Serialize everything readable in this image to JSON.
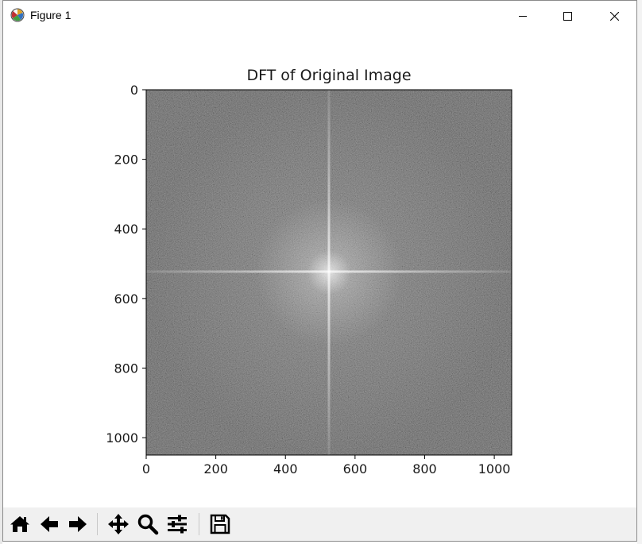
{
  "window": {
    "title": "Figure 1",
    "icons": [
      "matplotlib-logo-icon",
      "minimize-icon",
      "maximize-icon",
      "close-icon"
    ]
  },
  "toolbar": {
    "buttons": [
      "home-icon",
      "back-arrow-icon",
      "forward-arrow-icon",
      "pan-icon",
      "zoom-icon",
      "configure-subplots-icon",
      "save-icon"
    ]
  },
  "chart_data": {
    "type": "heatmap",
    "title": "DFT of Original Image",
    "xlabel": "",
    "ylabel": "",
    "xlim": [
      0,
      1050
    ],
    "ylim": [
      1050,
      0
    ],
    "x_ticks": [
      "0",
      "200",
      "400",
      "600",
      "800",
      "1000"
    ],
    "y_ticks": [
      "0",
      "200",
      "400",
      "600",
      "800",
      "1000"
    ],
    "colormap": "gray",
    "bright_center": [
      525,
      525
    ],
    "grid": false
  }
}
